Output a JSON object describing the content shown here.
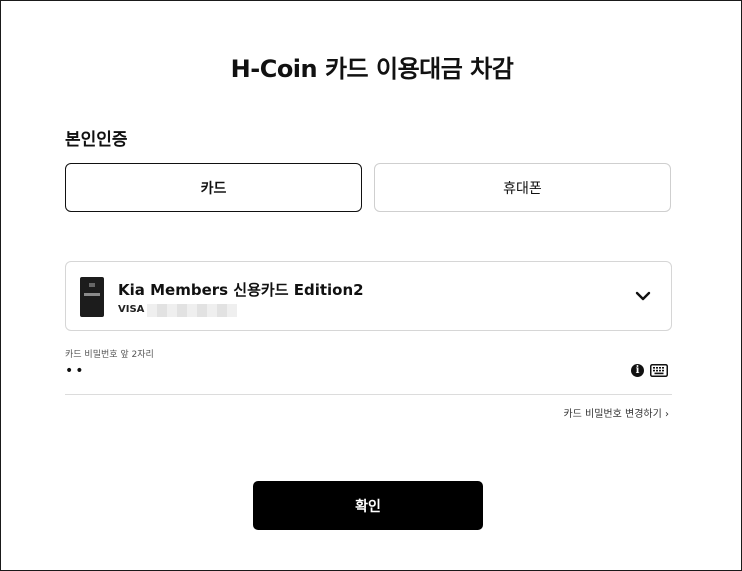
{
  "header": {
    "title": "H-Coin 카드 이용대금 차감"
  },
  "auth": {
    "section_title": "본인인증",
    "tabs": [
      {
        "label": "카드",
        "selected": true
      },
      {
        "label": "휴대폰",
        "selected": false
      }
    ]
  },
  "card": {
    "name": "Kia Members 신용카드 Edition2",
    "brand": "VISA",
    "icon": "chevron-down-icon"
  },
  "password": {
    "label": "카드 비밀번호 앞 2자리",
    "value_masked": "••",
    "icons": [
      "info-icon",
      "keyboard-icon"
    ]
  },
  "links": {
    "change_password": "카드 비밀번호 변경하기 ›"
  },
  "actions": {
    "confirm_label": "확인"
  },
  "colors": {
    "primary": "#000000",
    "border": "#d6d6d6",
    "text": "#111111"
  }
}
